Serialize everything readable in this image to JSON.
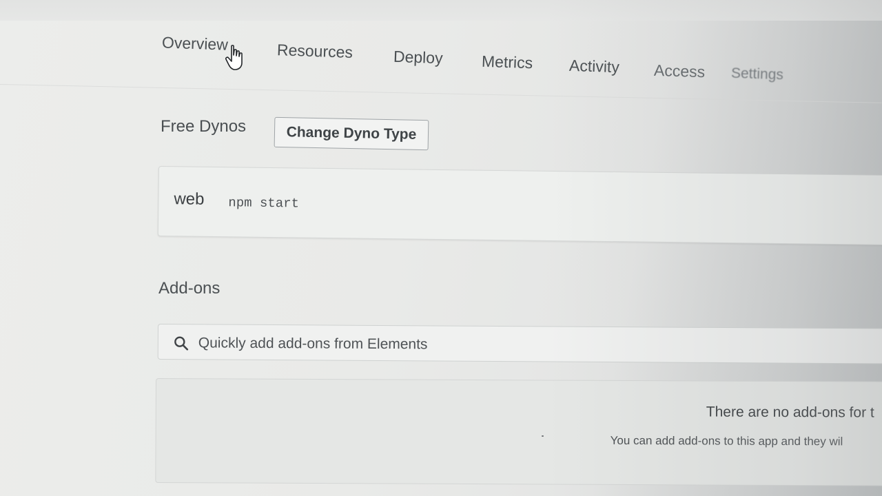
{
  "nav": {
    "tabs": [
      {
        "label": "Overview",
        "active": true
      },
      {
        "label": "Resources"
      },
      {
        "label": "Deploy"
      },
      {
        "label": "Metrics"
      },
      {
        "label": "Activity"
      },
      {
        "label": "Access"
      },
      {
        "label": "Settings"
      }
    ]
  },
  "dynos": {
    "heading": "Free Dynos",
    "change_button_label": "Change Dyno Type",
    "process": {
      "type": "web",
      "command": "npm start"
    }
  },
  "addons": {
    "heading": "Add-ons",
    "search_placeholder": "Quickly add add-ons from Elements",
    "empty_title": "There are no add-ons for t",
    "empty_subtitle": "You can add add-ons to this app and they wil"
  },
  "icons": {
    "search": "search-icon",
    "cursor": "hand-pointer-icon"
  }
}
